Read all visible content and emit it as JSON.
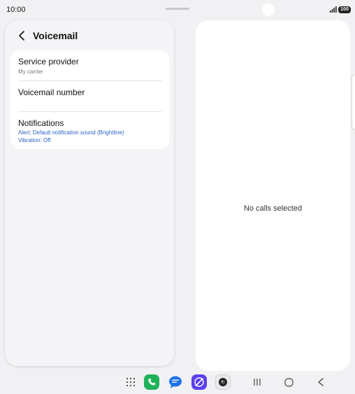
{
  "status_bar": {
    "time": "10:00",
    "battery": "100",
    "icons": [
      "signal-icon",
      "battery-icon"
    ]
  },
  "voicemail": {
    "title": "Voicemail",
    "back_icon": "chevron-left-icon",
    "items": [
      {
        "title": "Service provider",
        "subtitle": "My carrier"
      },
      {
        "title": "Voicemail number"
      },
      {
        "title": "Notifications",
        "alert": "Alert: Default notification sound (Brightline)",
        "vibration": "Vibration: Off"
      }
    ]
  },
  "detail_pane": {
    "empty_message": "No calls selected"
  },
  "taskbar": {
    "apps": [
      "apps-grid-icon",
      "phone-icon",
      "messages-icon",
      "internet-icon",
      "camera-icon"
    ],
    "nav": [
      "recents-icon",
      "home-icon",
      "back-icon"
    ]
  },
  "colors": {
    "accent_blue": "#2b63c8",
    "phone_green": "#1fb25a",
    "messages_blue": "#1d72e8",
    "internet_purple": "#5b3ff0",
    "background": "#f1f1f3"
  }
}
